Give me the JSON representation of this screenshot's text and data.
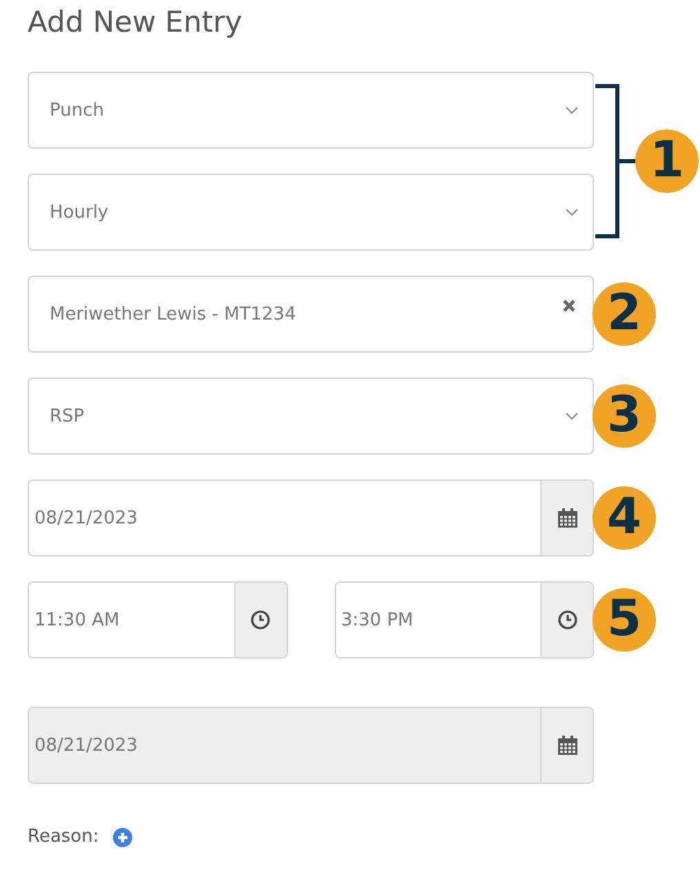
{
  "title": "Add New Entry",
  "groups": [
    {
      "callout": "1",
      "bracket": true,
      "kind": "stack",
      "fields": [
        {
          "kind": "select",
          "value": "Punch"
        },
        {
          "kind": "select",
          "value": "Hourly"
        }
      ]
    },
    {
      "callout": "2",
      "bracket": false,
      "kind": "stack",
      "fields": [
        {
          "kind": "clearable",
          "value": "Meriwether Lewis - MT1234"
        }
      ]
    },
    {
      "callout": "3",
      "bracket": false,
      "kind": "stack",
      "fields": [
        {
          "kind": "select",
          "value": "RSP"
        }
      ]
    },
    {
      "callout": "4",
      "bracket": false,
      "kind": "stack",
      "fields": [
        {
          "kind": "date",
          "value": "08/21/2023",
          "disabled": false
        }
      ]
    },
    {
      "callout": "5",
      "bracket": false,
      "kind": "row",
      "fields": [
        {
          "kind": "time",
          "value": "11:30 AM"
        },
        {
          "kind": "time",
          "value": "3:30 PM"
        }
      ]
    }
  ],
  "end_date": {
    "kind": "date",
    "value": "08/21/2023",
    "disabled": true
  },
  "reason": {
    "label": "Reason:"
  }
}
